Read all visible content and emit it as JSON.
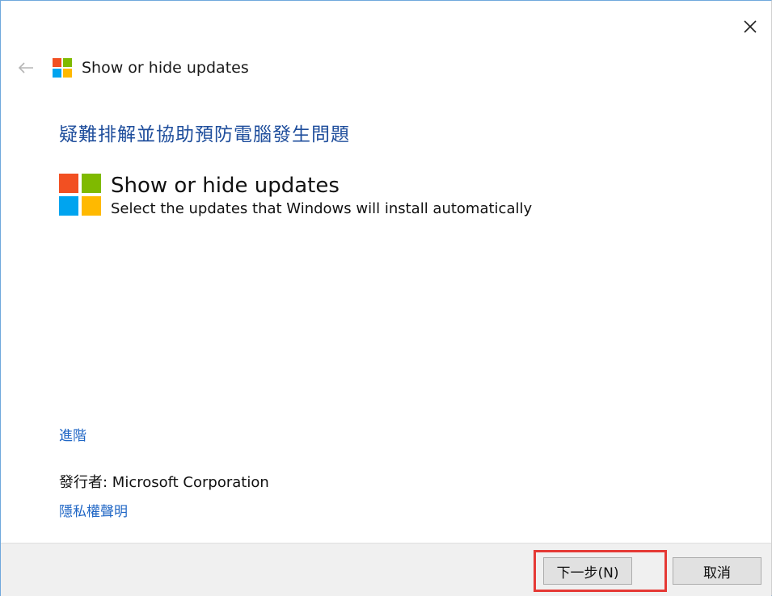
{
  "window": {
    "title": "Show or hide updates",
    "close_label": "×"
  },
  "main": {
    "heading": "疑難排解並協助預防電腦發生問題",
    "item": {
      "title": "Show or hide updates",
      "description": "Select the updates that Windows will install automatically"
    },
    "advanced_link": "進階",
    "publisher": "發行者:  Microsoft Corporation",
    "privacy_link": "隱私權聲明"
  },
  "footer": {
    "next_label": "下一步(N)",
    "cancel_label": "取消"
  },
  "colors": {
    "logo_red": "#f25022",
    "logo_green": "#7fba00",
    "logo_blue": "#00a4ef",
    "logo_yellow": "#ffb900",
    "heading_blue": "#1f4e9c",
    "link_blue": "#1f66c5",
    "highlight_red": "#e53935"
  },
  "icons": {
    "back": "back-arrow-icon",
    "close": "close-icon",
    "logo": "windows-logo-icon"
  }
}
